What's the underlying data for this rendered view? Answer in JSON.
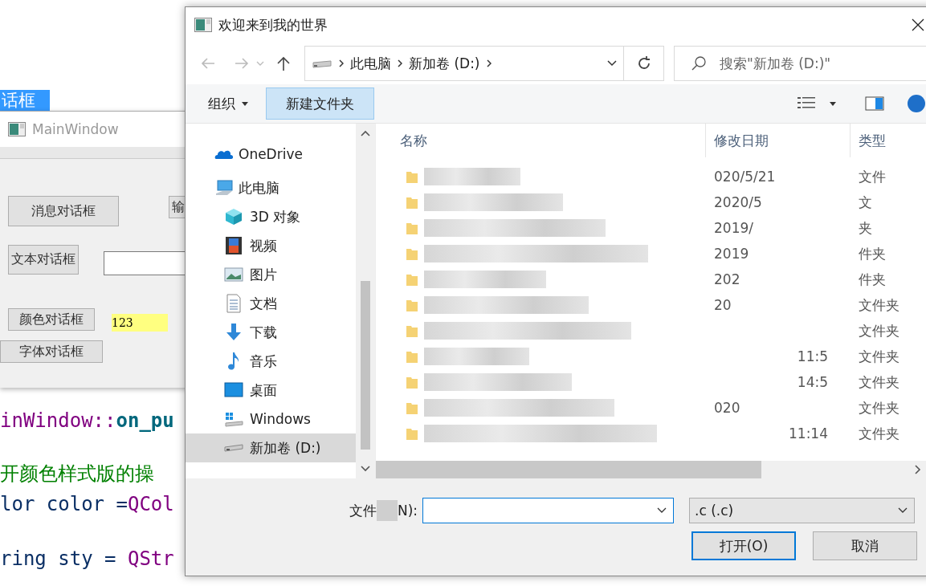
{
  "editor": {
    "highlight": "话框",
    "lines": [
      {
        "segments": [
          {
            "kind": "type",
            "text": "inWindow::"
          },
          {
            "kind": "func",
            "text": "on_pu"
          }
        ]
      },
      {
        "segments": [
          {
            "kind": "comment",
            "text": "开颜色样式版的操"
          }
        ]
      },
      {
        "segments": [
          {
            "kind": "plain",
            "text": "lor color ="
          },
          {
            "kind": "type",
            "text": "QCol"
          }
        ]
      },
      {
        "segments": [
          {
            "kind": "plain",
            "text": "ring sty = "
          },
          {
            "kind": "type",
            "text": "QStr"
          }
        ]
      }
    ]
  },
  "main_window": {
    "title": "MainWindow",
    "message_button": "消息对话框",
    "input_button": "输",
    "text_button": "文本对话框",
    "color_button": "颜色对话框",
    "color_label": "123",
    "font_button": "字体对话框"
  },
  "dialog": {
    "title": "欢迎来到我的世界",
    "breadcrumb": [
      "此电脑",
      "新加卷 (D:)"
    ],
    "search": {
      "placeholder": "搜索\"新加卷 (D:)\""
    },
    "toolbar": {
      "organize": "组织",
      "new_folder": "新建文件夹"
    },
    "nav_items": [
      {
        "label": "OneDrive",
        "selected": false
      },
      {
        "label": "此电脑",
        "selected": false,
        "children": [
          {
            "label": "3D 对象",
            "selected": false
          },
          {
            "label": "视频",
            "selected": false
          },
          {
            "label": "图片",
            "selected": false
          },
          {
            "label": "文档",
            "selected": false
          },
          {
            "label": "下载",
            "selected": false
          },
          {
            "label": "音乐",
            "selected": false
          },
          {
            "label": "桌面",
            "selected": false
          },
          {
            "label": "Windows",
            "selected": false
          },
          {
            "label": "新加卷 (D:)",
            "selected": true
          }
        ]
      }
    ],
    "columns": [
      "名称",
      "修改日期",
      "类型"
    ],
    "rows": [
      {
        "date": "020/5/21",
        "type": "文件"
      },
      {
        "date": "2020/5",
        "type": "文"
      },
      {
        "date": "2019/",
        "type": "夹"
      },
      {
        "date": "2019",
        "type": "件夹"
      },
      {
        "date": "202",
        "type": "件夹"
      },
      {
        "date": "20",
        "type": "文件夹"
      },
      {
        "type": "文件夹"
      },
      {
        "time": "11:5",
        "type": "文件夹"
      },
      {
        "time": "14:5",
        "type": "文件夹"
      },
      {
        "date": "020",
        "type": "文件夹"
      },
      {
        "time": "11:14",
        "type": "文件夹"
      }
    ],
    "filename_label_start": "文件",
    "filename_label_end": "N):",
    "filter": ".c (.c)",
    "open_button": "打开(O)",
    "cancel_button": "取消"
  }
}
